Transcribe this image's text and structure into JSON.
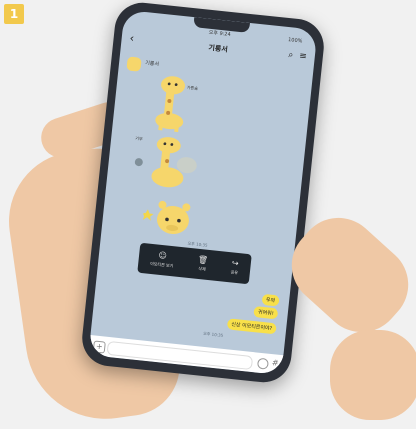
{
  "step": {
    "number": "1"
  },
  "status_bar": {
    "time": "오후 9:24",
    "battery": "100%"
  },
  "chat": {
    "title": "기롱서"
  },
  "sender": {
    "name": "기롱서"
  },
  "icons": {
    "back": "back-chevron-icon",
    "search": "search-icon",
    "menu": "hamburger-menu-icon",
    "plus": "plus-icon",
    "emoji": "emoji-icon",
    "hash": "hash-icon"
  },
  "colors": {
    "chat_background": "#b9c9d9",
    "my_bubble": "#f8e04a",
    "action_bar": "#1f262d"
  },
  "stickers": [
    {
      "label": "가쁜숨"
    },
    {
      "label": "기부"
    },
    {
      "label": ""
    }
  ],
  "sticker_time": "오후 10:35",
  "action_bar": {
    "items": [
      {
        "label": "이모티콘 보기",
        "icon": "emoticon-icon"
      },
      {
        "label": "삭제",
        "icon": "trash-icon"
      },
      {
        "label": "공유",
        "icon": "share-arrow-icon"
      }
    ]
  },
  "messages": [
    {
      "text": "우와"
    },
    {
      "text": "귀여워!"
    },
    {
      "text": "신상 이모티콘이야?"
    }
  ],
  "message_time": "오후 10:35"
}
